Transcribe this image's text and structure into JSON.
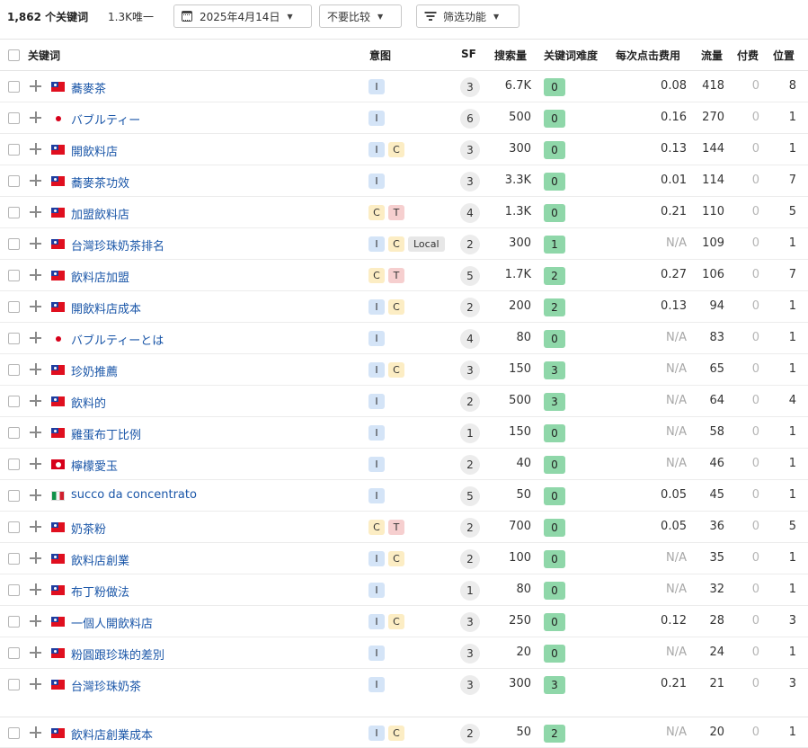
{
  "toolbar": {
    "keyword_count": "1,862 个关键词",
    "unique": "1.3K唯一",
    "date_label": "2025年4月14日",
    "compare_label": "不要比较",
    "filter_label": "筛选功能"
  },
  "columns": {
    "keyword": "关键词",
    "intent": "意图",
    "sf": "SF",
    "volume": "搜索量",
    "kd": "关键词难度",
    "cpc": "每次点击费用",
    "traffic": "流量",
    "paid": "付费",
    "position": "位置"
  },
  "rows": [
    {
      "flag": "tw",
      "keyword": "蕎麥茶",
      "intents": [
        "I"
      ],
      "sf": "3",
      "volume": "6.7K",
      "kd": "0",
      "cpc": "0.08",
      "traffic": "418",
      "paid": "0",
      "position": "8"
    },
    {
      "flag": "jp",
      "keyword": "バブルティー",
      "intents": [
        "I"
      ],
      "sf": "6",
      "volume": "500",
      "kd": "0",
      "cpc": "0.16",
      "traffic": "270",
      "paid": "0",
      "position": "1"
    },
    {
      "flag": "tw",
      "keyword": "開飲料店",
      "intents": [
        "I",
        "C"
      ],
      "sf": "3",
      "volume": "300",
      "kd": "0",
      "cpc": "0.13",
      "traffic": "144",
      "paid": "0",
      "position": "1"
    },
    {
      "flag": "tw",
      "keyword": "蕎麥茶功效",
      "intents": [
        "I"
      ],
      "sf": "3",
      "volume": "3.3K",
      "kd": "0",
      "cpc": "0.01",
      "traffic": "114",
      "paid": "0",
      "position": "7"
    },
    {
      "flag": "tw",
      "keyword": "加盟飲料店",
      "intents": [
        "C",
        "T"
      ],
      "sf": "4",
      "volume": "1.3K",
      "kd": "0",
      "cpc": "0.21",
      "traffic": "110",
      "paid": "0",
      "position": "5"
    },
    {
      "flag": "tw",
      "keyword": "台灣珍珠奶茶排名",
      "intents": [
        "I",
        "C",
        "Local"
      ],
      "sf": "2",
      "volume": "300",
      "kd": "1",
      "cpc": "N/A",
      "traffic": "109",
      "paid": "0",
      "position": "1"
    },
    {
      "flag": "tw",
      "keyword": "飲料店加盟",
      "intents": [
        "C",
        "T"
      ],
      "sf": "5",
      "volume": "1.7K",
      "kd": "2",
      "cpc": "0.27",
      "traffic": "106",
      "paid": "0",
      "position": "7"
    },
    {
      "flag": "tw",
      "keyword": "開飲料店成本",
      "intents": [
        "I",
        "C"
      ],
      "sf": "2",
      "volume": "200",
      "kd": "2",
      "cpc": "0.13",
      "traffic": "94",
      "paid": "0",
      "position": "1"
    },
    {
      "flag": "jp",
      "keyword": "バブルティーとは",
      "intents": [
        "I"
      ],
      "sf": "4",
      "volume": "80",
      "kd": "0",
      "cpc": "N/A",
      "traffic": "83",
      "paid": "0",
      "position": "1"
    },
    {
      "flag": "tw",
      "keyword": "珍奶推薦",
      "intents": [
        "I",
        "C"
      ],
      "sf": "3",
      "volume": "150",
      "kd": "3",
      "cpc": "N/A",
      "traffic": "65",
      "paid": "0",
      "position": "1"
    },
    {
      "flag": "tw",
      "keyword": "飲料的",
      "intents": [
        "I"
      ],
      "sf": "2",
      "volume": "500",
      "kd": "3",
      "cpc": "N/A",
      "traffic": "64",
      "paid": "0",
      "position": "4"
    },
    {
      "flag": "tw",
      "keyword": "雞蛋布丁比例",
      "intents": [
        "I"
      ],
      "sf": "1",
      "volume": "150",
      "kd": "0",
      "cpc": "N/A",
      "traffic": "58",
      "paid": "0",
      "position": "1"
    },
    {
      "flag": "hk",
      "keyword": "檸檬愛玉",
      "intents": [
        "I"
      ],
      "sf": "2",
      "volume": "40",
      "kd": "0",
      "cpc": "N/A",
      "traffic": "46",
      "paid": "0",
      "position": "1"
    },
    {
      "flag": "it",
      "keyword": "succo da concentrato",
      "intents": [
        "I"
      ],
      "sf": "5",
      "volume": "50",
      "kd": "0",
      "cpc": "0.05",
      "traffic": "45",
      "paid": "0",
      "position": "1"
    },
    {
      "flag": "tw",
      "keyword": "奶茶粉",
      "intents": [
        "C",
        "T"
      ],
      "sf": "2",
      "volume": "700",
      "kd": "0",
      "cpc": "0.05",
      "traffic": "36",
      "paid": "0",
      "position": "5"
    },
    {
      "flag": "tw",
      "keyword": "飲料店創業",
      "intents": [
        "I",
        "C"
      ],
      "sf": "2",
      "volume": "100",
      "kd": "0",
      "cpc": "N/A",
      "traffic": "35",
      "paid": "0",
      "position": "1"
    },
    {
      "flag": "tw",
      "keyword": "布丁粉做法",
      "intents": [
        "I"
      ],
      "sf": "1",
      "volume": "80",
      "kd": "0",
      "cpc": "N/A",
      "traffic": "32",
      "paid": "0",
      "position": "1"
    },
    {
      "flag": "tw",
      "keyword": "一個人開飲料店",
      "intents": [
        "I",
        "C"
      ],
      "sf": "3",
      "volume": "250",
      "kd": "0",
      "cpc": "0.12",
      "traffic": "28",
      "paid": "0",
      "position": "3"
    },
    {
      "flag": "tw",
      "keyword": "粉圓跟珍珠的差別",
      "intents": [
        "I"
      ],
      "sf": "3",
      "volume": "20",
      "kd": "0",
      "cpc": "N/A",
      "traffic": "24",
      "paid": "0",
      "position": "1"
    },
    {
      "flag": "tw",
      "keyword": "台灣珍珠奶茶",
      "intents": [
        "I"
      ],
      "sf": "3",
      "volume": "300",
      "kd": "3",
      "cpc": "0.21",
      "traffic": "21",
      "paid": "0",
      "position": "3"
    },
    {
      "flag": "tw",
      "keyword": "飲料店創業成本",
      "intents": [
        "I",
        "C"
      ],
      "sf": "2",
      "volume": "50",
      "kd": "2",
      "cpc": "N/A",
      "traffic": "20",
      "paid": "0",
      "position": "1"
    }
  ]
}
